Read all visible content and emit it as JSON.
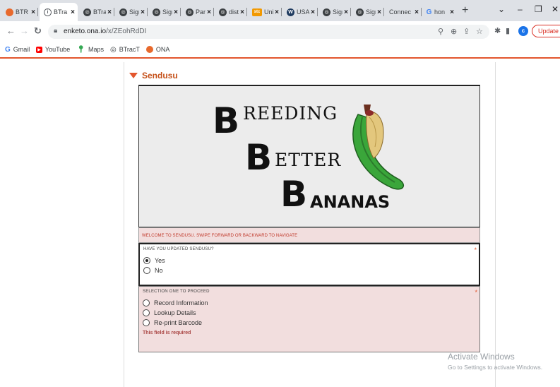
{
  "browser": {
    "tabs": [
      {
        "title": "BTR",
        "icon": "orange-circle-icon",
        "color": "#e8692c",
        "active": false
      },
      {
        "title": "BTra",
        "icon": "info-icon",
        "color": "#5f6368",
        "active": true
      },
      {
        "title": "BTra",
        "icon": "globe-icon",
        "color": "#3c4043",
        "active": false
      },
      {
        "title": "Sign",
        "icon": "globe-icon",
        "color": "#3c4043",
        "active": false
      },
      {
        "title": "Sign",
        "icon": "globe-icon",
        "color": "#3c4043",
        "active": false
      },
      {
        "title": "Parc",
        "icon": "globe-icon",
        "color": "#3c4043",
        "active": false
      },
      {
        "title": "distr",
        "icon": "globe-icon",
        "color": "#3c4043",
        "active": false
      },
      {
        "title": "Uni",
        "icon": "stc-icon",
        "color": "#f29900",
        "active": false
      },
      {
        "title": "USA",
        "icon": "wordpress-icon",
        "color": "#1e3a5f",
        "active": false
      },
      {
        "title": "Sign",
        "icon": "globe-icon",
        "color": "#3c4043",
        "active": false
      },
      {
        "title": "Sign",
        "icon": "globe-icon",
        "color": "#3c4043",
        "active": false
      },
      {
        "title": "Connec",
        "icon": "none",
        "color": "#3c4043",
        "active": false
      },
      {
        "title": "hon",
        "icon": "google-icon",
        "color": "#4285f4",
        "active": false
      }
    ],
    "url_host": "enketo.ona.io",
    "url_path": "/x/ZEohRdDI",
    "profile_initial": "c",
    "update_label": "Update",
    "bookmarks": [
      {
        "label": "Gmail",
        "icon": "google-g-icon",
        "color": "#4285f4"
      },
      {
        "label": "YouTube",
        "icon": "youtube-icon",
        "color": "#ff0000"
      },
      {
        "label": "Maps",
        "icon": "maps-pin-icon",
        "color": "#34a853"
      },
      {
        "label": "BTracT",
        "icon": "globe-icon",
        "color": "#3c4043"
      },
      {
        "label": "ONA",
        "icon": "orange-dot-icon",
        "color": "#e8692c"
      }
    ]
  },
  "form": {
    "group_title": "Sendusu",
    "banner": {
      "line1_big": "B",
      "line1_rest": "REEDING",
      "line2_big": "B",
      "line2_rest": "ETTER",
      "line3_big": "B",
      "line3_rest": "ANANAS"
    },
    "welcome_note": "WELCOME TO SENDUSU. SWIPE FORWARD OR BACKWARD TO NAVIGATE",
    "q1": {
      "label": "HAVE YOU UPDATED SENDUSU?",
      "required_mark": "*",
      "options": [
        "Yes",
        "No"
      ],
      "selected": "Yes"
    },
    "q2": {
      "label": "SELECTION ONE TO PROCEED",
      "required_mark": "*",
      "options": [
        "Record Information",
        "Lookup Details",
        "Re-print Barcode"
      ],
      "error": "This field is required"
    }
  },
  "watermark": {
    "title": "Activate Windows",
    "subtitle": "Go to Settings to activate Windows."
  },
  "colors": {
    "accent": "#e3562d",
    "error_bg": "#f2dede",
    "error_text": "#a94442"
  }
}
